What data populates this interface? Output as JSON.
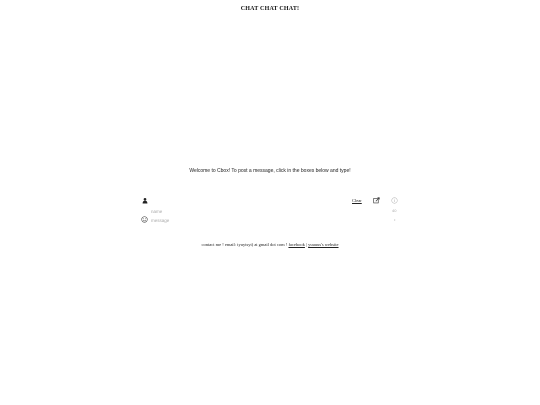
{
  "header": {
    "title": "CHAT CHAT CHAT!"
  },
  "main": {
    "welcome_text": "Welcome to Cbox! To post a message, click in the boxes below and type!"
  },
  "composer": {
    "clear_label": "Clear",
    "name_placeholder": "name",
    "name_remaining": "40",
    "message_placeholder": "message",
    "message_remaining": "•"
  },
  "footer": {
    "contact_text": "contact me ! email: tyuytsyt) at gmail dot com ! ",
    "separator": " | ",
    "facebook_label": "facebook",
    "website_label": "yuuuus's website"
  },
  "icons": {
    "user": "user-icon",
    "edit": "edit-icon",
    "info": "info-icon",
    "smile": "smile-icon"
  }
}
